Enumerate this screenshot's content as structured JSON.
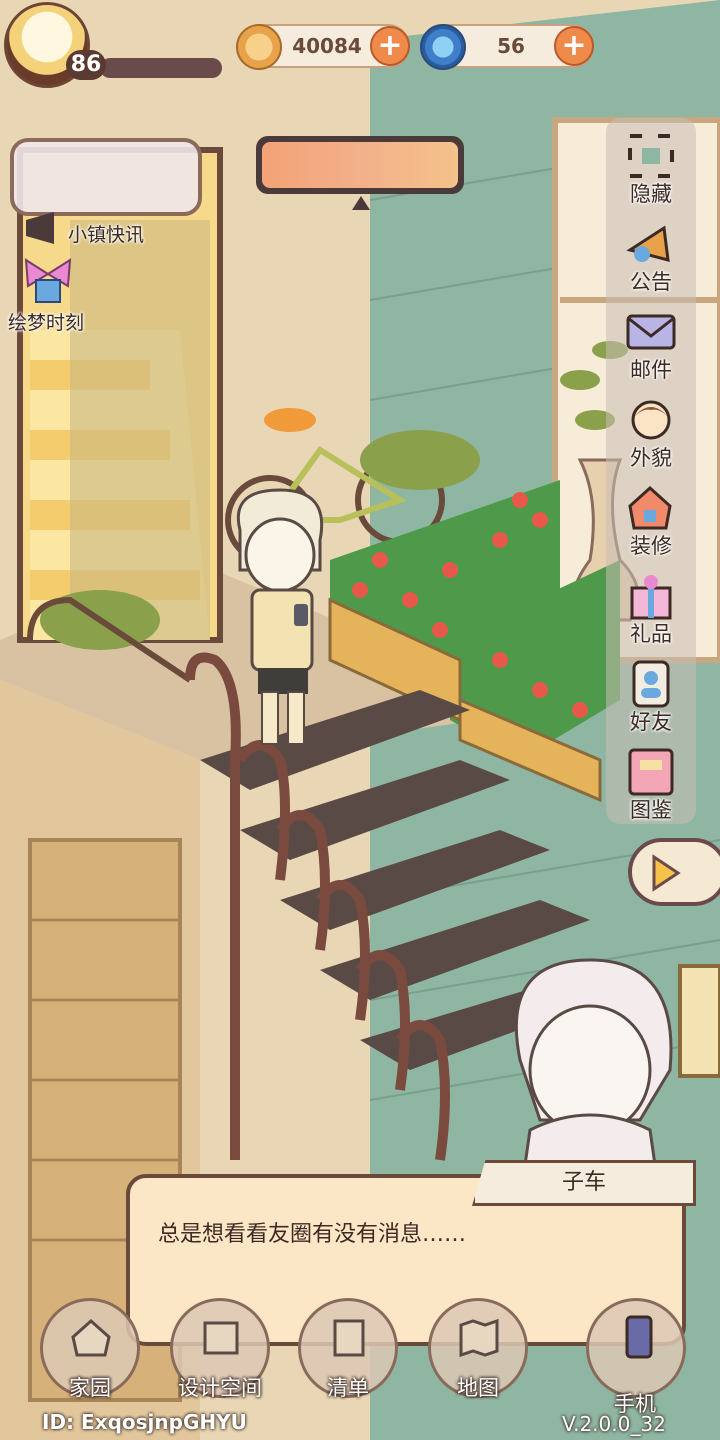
{
  "player": {
    "level": "86"
  },
  "resources": {
    "coins": "40084",
    "gems": "56"
  },
  "side_left": {
    "news_label": "小镇快讯",
    "event_label": "绘梦时刻"
  },
  "right_menu": [
    {
      "label": "隐藏",
      "icon": "hide-icon"
    },
    {
      "label": "公告",
      "icon": "announcement-icon"
    },
    {
      "label": "邮件",
      "icon": "mail-icon"
    },
    {
      "label": "外貌",
      "icon": "appearance-icon"
    },
    {
      "label": "装修",
      "icon": "decorate-icon"
    },
    {
      "label": "礼品",
      "icon": "gift-icon"
    },
    {
      "label": "好友",
      "icon": "friends-icon"
    },
    {
      "label": "图鉴",
      "icon": "catalog-icon"
    }
  ],
  "dialog": {
    "speaker": "子车",
    "text": "总是想看看友圈有没有消息……"
  },
  "bottom_nav": [
    {
      "label": "家园",
      "icon": "home-icon"
    },
    {
      "label": "设计空间",
      "icon": "design-icon"
    },
    {
      "label": "清单",
      "icon": "list-icon"
    },
    {
      "label": "地图",
      "icon": "map-icon"
    },
    {
      "label": "手机",
      "icon": "phone-icon"
    }
  ],
  "footer": {
    "uid": "ID: ExqosjnpGHYU",
    "version": "V.2.0.0_32"
  },
  "colors": {
    "accent": "#f08a4a",
    "panel": "#fbe7c6",
    "border": "#6a4a3a",
    "wall": "#8fb6a2"
  }
}
